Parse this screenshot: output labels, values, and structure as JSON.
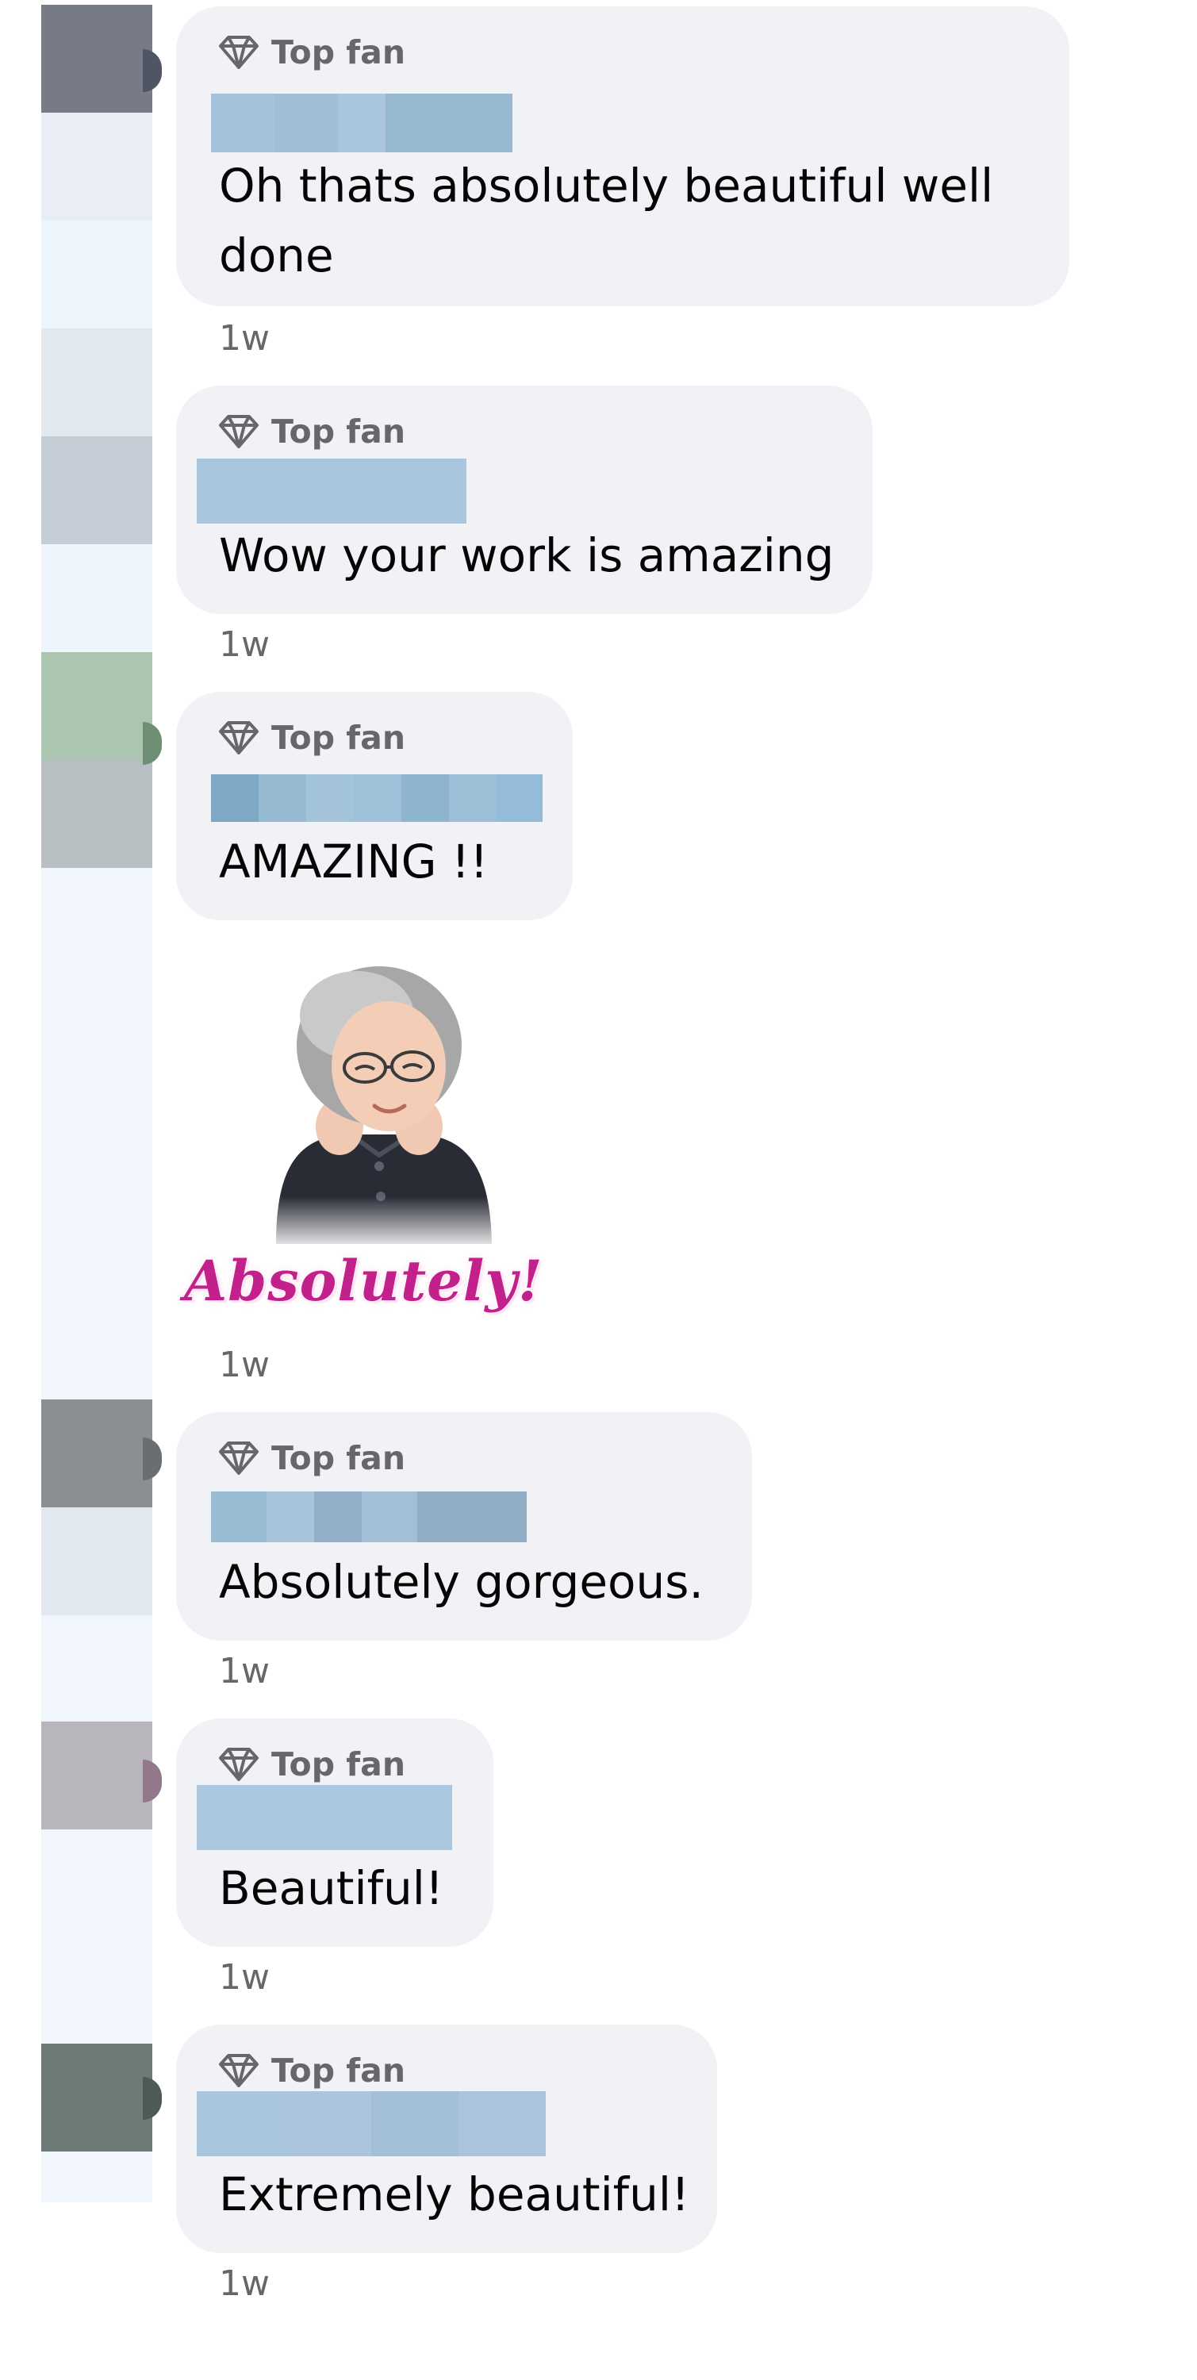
{
  "comments": [
    {
      "badge": "Top fan",
      "text": "Oh thats absolutely beautiful well\ndone",
      "time": "1w"
    },
    {
      "badge": "Top fan",
      "text": "Wow your work is amazing",
      "time": "1w"
    },
    {
      "badge": "Top fan",
      "text": "AMAZING !!",
      "time": "1w"
    },
    {
      "badge": "Top fan",
      "text": "Absolutely gorgeous.",
      "time": "1w"
    },
    {
      "badge": "Top fan",
      "text": "Beautiful!",
      "time": "1w"
    },
    {
      "badge": "Top fan",
      "text": "Extremely beautiful!",
      "time": "1w"
    }
  ],
  "sticker": {
    "text": "Absolutely!",
    "time": "1w"
  },
  "icons": {
    "badge": "diamond-icon"
  },
  "colors": {
    "bubble": "#f0f2f5",
    "badge_text": "#65676b",
    "comment_text": "#050505",
    "timestamp": "#65676b",
    "name_redaction": "#a9c6dd",
    "sticker_text": "#c2208a"
  }
}
